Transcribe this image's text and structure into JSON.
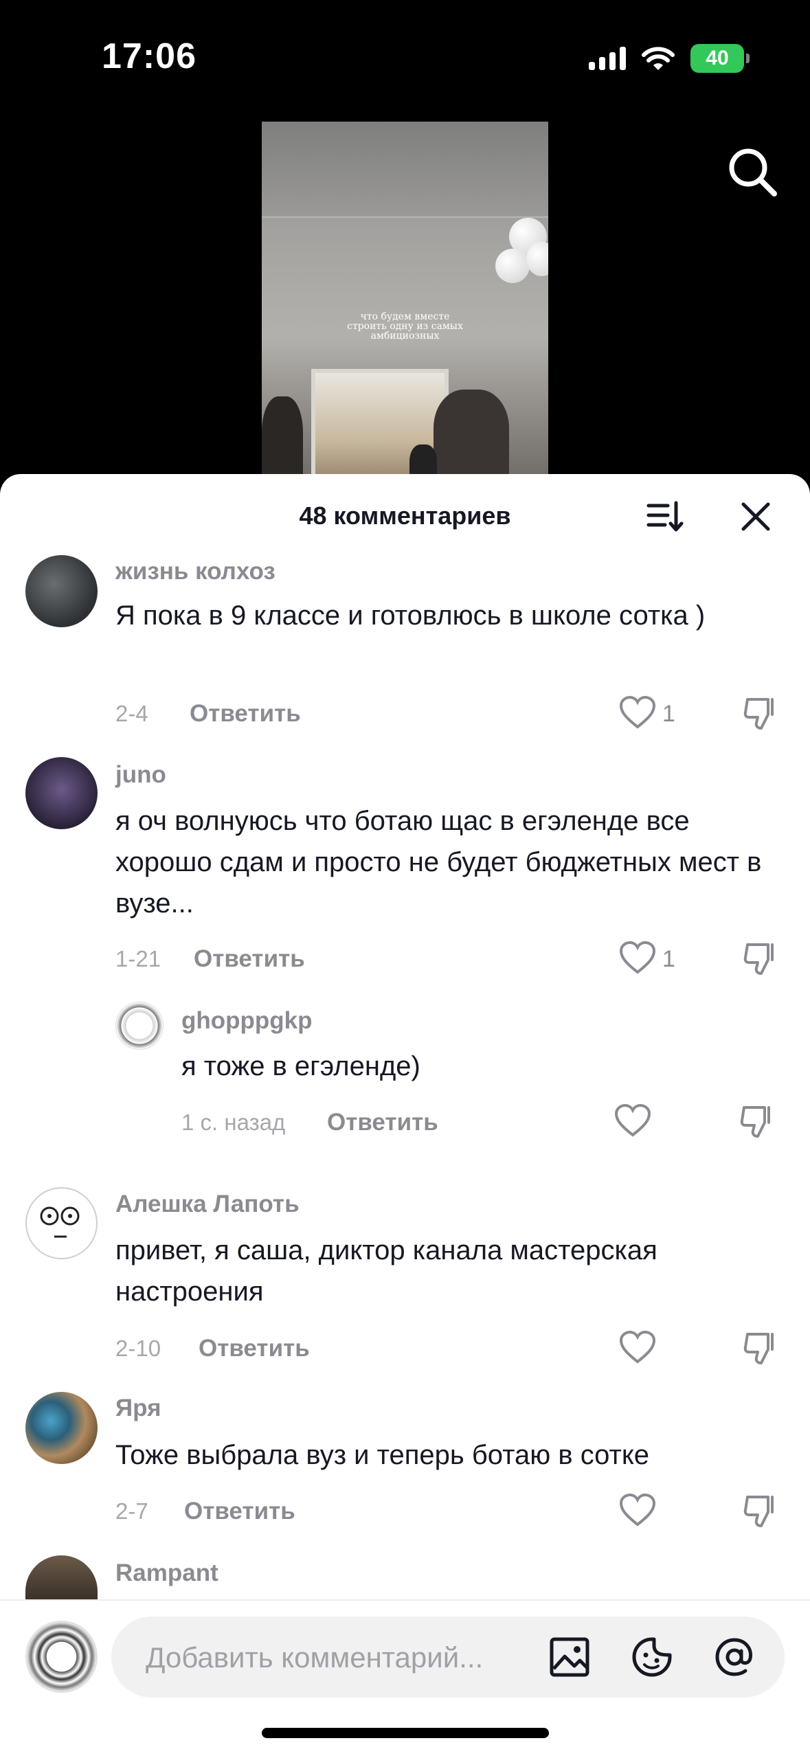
{
  "status_bar": {
    "time": "17:06",
    "battery": "40"
  },
  "video": {
    "caption_lines": [
      "что будем вместе",
      "строить одну из самых",
      "амбициозных"
    ]
  },
  "header": {
    "title": "48 комментариев"
  },
  "comments": [
    {
      "user": "жизнь колхоз",
      "text": "Я пока в 9 классе и готовлюсь в школе сотка )",
      "date": "2-4",
      "reply_label": "Ответить",
      "likes": "1"
    },
    {
      "user": "juno",
      "text": "я оч волнуюсь что ботаю щас в егэленде все хорошо сдам и просто не будет бюджетных мест в вузе...",
      "date": "1-21",
      "reply_label": "Ответить",
      "likes": "1"
    },
    {
      "user": "ghopppgkp",
      "text": "я тоже в егэленде)",
      "date": "1 с. назад",
      "reply_label": "Ответить",
      "likes": ""
    },
    {
      "user": "Алешка Лапоть",
      "text": "привет, я саша, диктор канала мастерская настроения",
      "date": "2-10",
      "reply_label": "Ответить",
      "likes": ""
    },
    {
      "user": "Яря",
      "text": "Тоже выбрала вуз и теперь ботаю в сотке",
      "date": "2-7",
      "reply_label": "Ответить",
      "likes": ""
    },
    {
      "user": "Rampant"
    }
  ],
  "input": {
    "placeholder": "Добавить комментарий..."
  },
  "colors": {
    "accent_battery": "#34c759",
    "text_primary": "#161823",
    "text_secondary": "#8a8b91"
  }
}
